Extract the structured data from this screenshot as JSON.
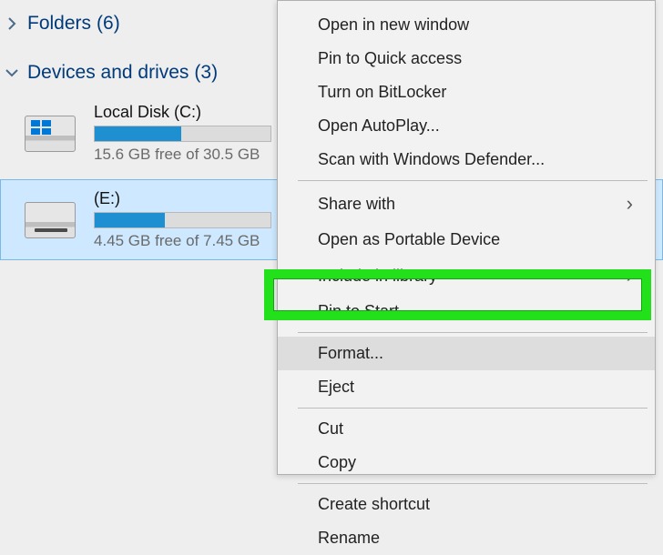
{
  "sections": {
    "folders": {
      "label": "Folders",
      "count": "(6)",
      "expanded": false
    },
    "drives": {
      "label": "Devices and drives",
      "count": "(3)",
      "expanded": true
    }
  },
  "drives": [
    {
      "name": "Local Disk (C:)",
      "free": "15.6 GB free of 30.5 GB",
      "fill_pct": 49,
      "kind": "windows",
      "selected": false
    },
    {
      "name": "(E:)",
      "free": "4.45 GB free of 7.45 GB",
      "fill_pct": 40,
      "kind": "slot",
      "selected": true
    }
  ],
  "menu": {
    "open_new_window": "Open in new window",
    "pin_quick": "Pin to Quick access",
    "bitlocker": "Turn on BitLocker",
    "autoplay": "Open AutoPlay...",
    "defender": "Scan with Windows Defender...",
    "share_with": "Share with",
    "portable": "Open as Portable Device",
    "include_library": "Include in library",
    "pin_start": "Pin to Start",
    "format": "Format...",
    "eject": "Eject",
    "cut": "Cut",
    "copy": "Copy",
    "shortcut": "Create shortcut",
    "rename": "Rename"
  }
}
